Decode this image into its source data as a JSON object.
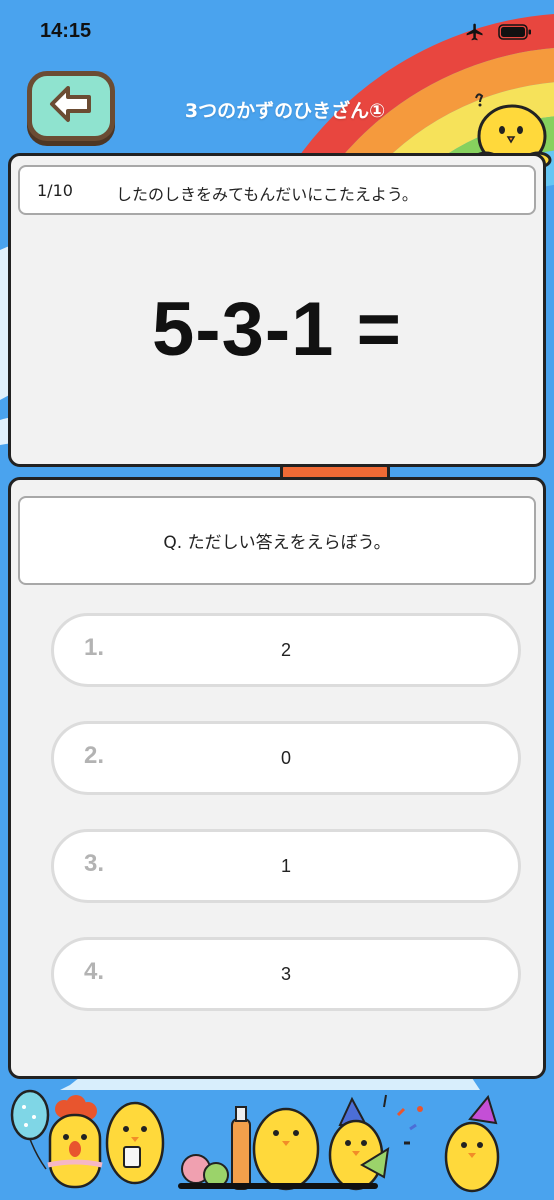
{
  "status": {
    "time": "14:15"
  },
  "header": {
    "title": "3つのかずのひきざん①"
  },
  "quiz": {
    "progress": "1/10",
    "instruction": "したのしきをみてもんだいにこたえよう。",
    "equation": "5-3-1 =",
    "question": "Q. ただしい答えをえらぼう。",
    "choices": [
      {
        "number": "1.",
        "value": "2"
      },
      {
        "number": "2.",
        "value": "0"
      },
      {
        "number": "3.",
        "value": "1"
      },
      {
        "number": "4.",
        "value": "3"
      }
    ]
  },
  "colors": {
    "background": "#4aa3ee",
    "back_button": "#8fe3cf",
    "card": "#f2f2f2",
    "choice_number": "#b3b3b3",
    "accent_tab": "#f06a35"
  },
  "icons": {
    "back": "arrow-left-icon",
    "airplane": "airplane-icon",
    "battery": "battery-icon"
  }
}
